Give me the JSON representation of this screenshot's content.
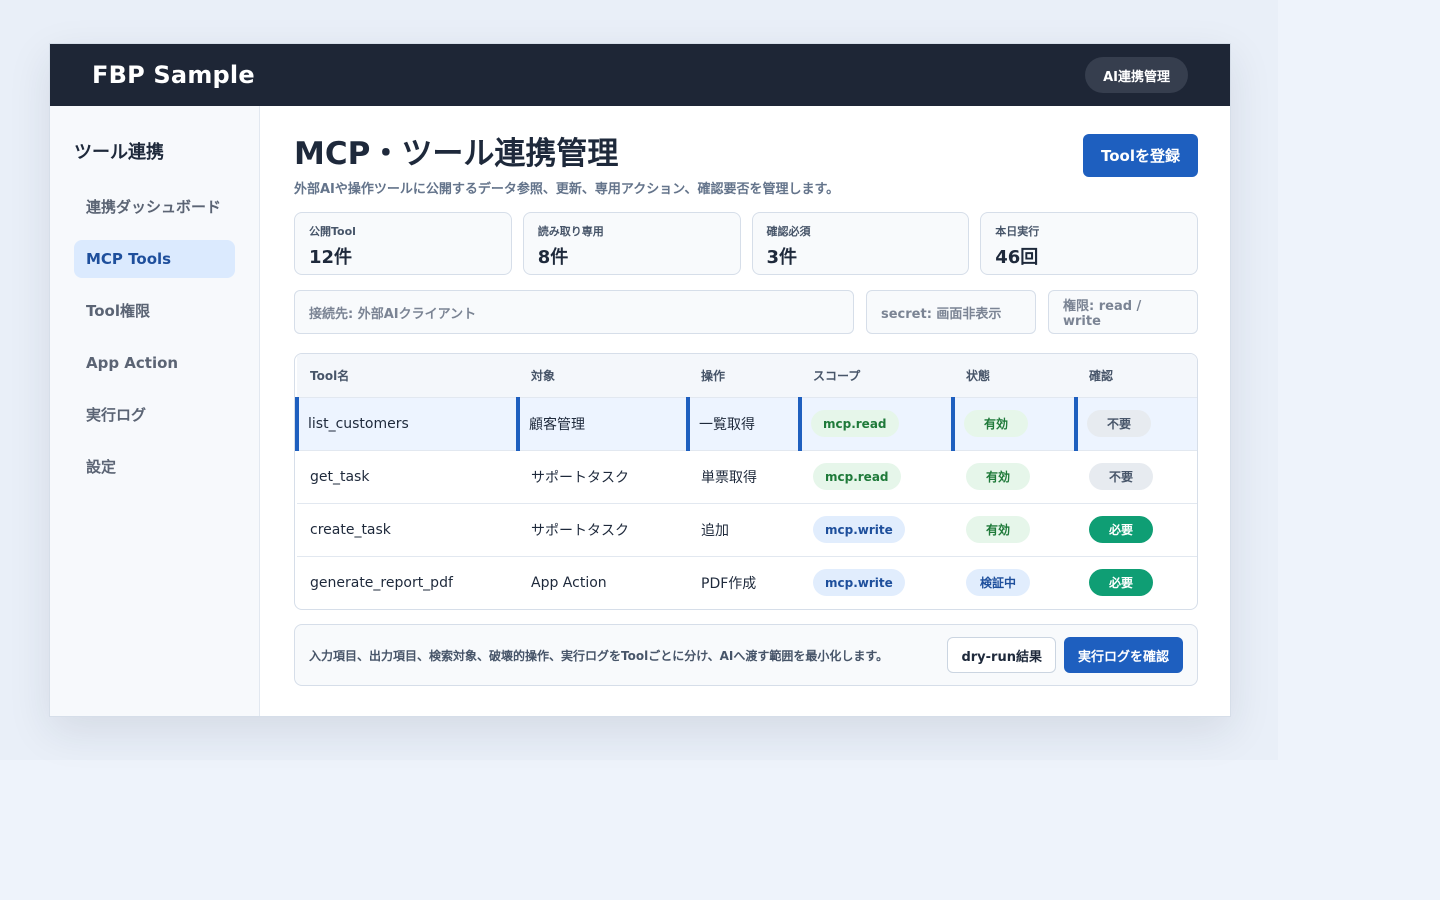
{
  "header": {
    "brand": "FBP Sample",
    "pill": "AI連携管理"
  },
  "sidebar": {
    "title": "ツール連携",
    "items": [
      {
        "label": "連携ダッシュボード"
      },
      {
        "label": "MCP Tools",
        "active": true
      },
      {
        "label": "Tool権限"
      },
      {
        "label": "App Action"
      },
      {
        "label": "実行ログ"
      },
      {
        "label": "設定"
      }
    ]
  },
  "main": {
    "title": "MCP・ツール連携管理",
    "subtitle": "外部AIや操作ツールに公開するデータ参照、更新、専用アクション、確認要否を管理します。",
    "register_button": "Toolを登録"
  },
  "stats": [
    {
      "label": "公開Tool",
      "value": "12件"
    },
    {
      "label": "読み取り専用",
      "value": "8件"
    },
    {
      "label": "確認必須",
      "value": "3件"
    },
    {
      "label": "本日実行",
      "value": "46回"
    }
  ],
  "filters": {
    "connection": "接続先: 外部AIクライアント",
    "secret": "secret: 画面非表示",
    "permission": "権限: read / write"
  },
  "table": {
    "headers": [
      "Tool名",
      "対象",
      "操作",
      "スコープ",
      "状態",
      "確認"
    ],
    "rows": [
      {
        "name": "list_customers",
        "target": "顧客管理",
        "op": "一覧取得",
        "scope": "mcp.read",
        "status": "有効",
        "confirm": "不要"
      },
      {
        "name": "get_task",
        "target": "サポートタスク",
        "op": "単票取得",
        "scope": "mcp.read",
        "status": "有効",
        "confirm": "不要"
      },
      {
        "name": "create_task",
        "target": "サポートタスク",
        "op": "追加",
        "scope": "mcp.write",
        "status": "有効",
        "confirm": "必要"
      },
      {
        "name": "generate_report_pdf",
        "target": "App Action",
        "op": "PDF作成",
        "scope": "mcp.write",
        "status": "検証中",
        "confirm": "必要"
      }
    ]
  },
  "footer": {
    "note": "入力項目、出力項目、検索対象、破壊的操作、実行ログをToolごとに分け、AIへ渡す範囲を最小化します。",
    "dry_run": "dry-run結果",
    "view_logs": "実行ログを確認"
  },
  "colors": {
    "topbar": "#1e2636",
    "accent": "#1e5fbf",
    "required": "#0f9e74"
  }
}
